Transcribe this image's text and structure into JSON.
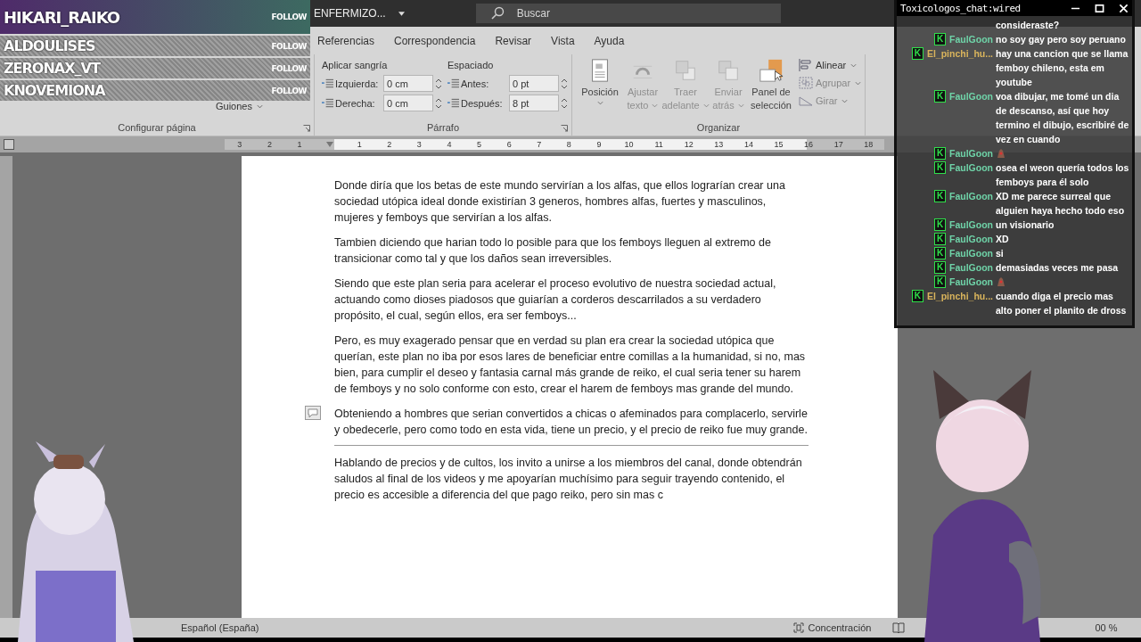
{
  "title_bar": {
    "document": "ENFERMIZO...",
    "search_placeholder": "Buscar"
  },
  "followers": [
    {
      "name": "HIKARI_RAIKO",
      "action": "FOLLOW"
    },
    {
      "name": "ALDOULISES",
      "action": "FOLLOW"
    },
    {
      "name": "ZERONAX_VT",
      "action": "FOLLOW"
    },
    {
      "name": "KNOVEMIONA",
      "action": "FOLLOW"
    }
  ],
  "ribbon_tabs": [
    "Referencias",
    "Correspondencia",
    "Revisar",
    "Vista",
    "Ayuda"
  ],
  "ribbon": {
    "page_setup": {
      "buttons": [
        "Guiones"
      ],
      "label": "Configurar página"
    },
    "paragraph": {
      "indent": {
        "title": "Aplicar sangría",
        "fields": [
          {
            "label": "Izquierda:",
            "value": "0 cm"
          },
          {
            "label": "Derecha:",
            "value": "0 cm"
          }
        ]
      },
      "spacing": {
        "title": "Espaciado",
        "fields": [
          {
            "label": "Antes:",
            "value": "0 pt"
          },
          {
            "label": "Después:",
            "value": "8 pt"
          }
        ]
      },
      "label": "Párrafo"
    },
    "arrange": {
      "large_buttons": [
        {
          "kind": "position",
          "lines": [
            "Posición"
          ],
          "dropdown": true,
          "disabled": false
        },
        {
          "kind": "wrap",
          "lines": [
            "Ajustar",
            "texto"
          ],
          "dropdown": true,
          "disabled": true
        },
        {
          "kind": "forward",
          "lines": [
            "Traer",
            "adelante"
          ],
          "dropdown": true,
          "disabled": true
        },
        {
          "kind": "backward",
          "lines": [
            "Enviar",
            "atrás"
          ],
          "dropdown": true,
          "disabled": true
        },
        {
          "kind": "selection",
          "lines": [
            "Panel de",
            "selección"
          ],
          "dropdown": false,
          "disabled": false
        }
      ],
      "small_buttons": [
        {
          "kind": "align",
          "label": "Alinear",
          "disabled": false
        },
        {
          "kind": "group",
          "label": "Agrupar",
          "disabled": true
        },
        {
          "kind": "rotate",
          "label": "Girar",
          "disabled": true
        }
      ],
      "label": "Organizar"
    }
  },
  "ruler": [
    "3",
    "2",
    "1",
    "1",
    "2",
    "3",
    "4",
    "5",
    "6",
    "7",
    "8",
    "9",
    "10",
    "11",
    "12",
    "13",
    "14",
    "15",
    "16",
    "17",
    "18"
  ],
  "paragraphs": [
    {
      "text": "Donde diría que los betas de este mundo servirían a los alfas, que ellos lograrían crear una sociedad utópica ideal donde existirían 3 generos, hombres alfas, fuertes y masculinos, mujeres y femboys que servirían a los alfas.",
      "comment": false,
      "border_below": false
    },
    {
      "text": "Tambien diciendo que harian todo lo posible para que los femboys lleguen al extremo de transicionar como tal y que los daños sean irreversibles.",
      "comment": false,
      "border_below": false
    },
    {
      "text": "Siendo que este plan seria para acelerar el proceso evolutivo de nuestra sociedad actual, actuando como dioses piadosos que guiarían a corderos descarrilados a su verdadero propósito, el cual, según ellos, era ser femboys...",
      "comment": false,
      "border_below": false
    },
    {
      "text": "Pero, es muy exagerado pensar que en verdad su plan era crear la sociedad utópica que querían, este plan no iba por esos lares de beneficiar entre comillas a la humanidad, si no, mas bien, para cumplir el deseo y fantasia carnal más grande de reiko, el cual seria tener su harem de femboys y no solo conforme con esto, crear el harem de femboys mas grande del mundo.",
      "comment": false,
      "border_below": false
    },
    {
      "text": "Obteniendo a hombres que serian convertidos a chicas o afeminados para complacerlo, servirle y obedecerle, pero como todo en esta vida, tiene un precio, y el precio de reiko fue muy grande.",
      "comment": true,
      "border_below": true
    },
    {
      "text": "Hablando de precios y de cultos, los invito a unirse a los miembros del canal, donde obtendrán saludos al final de los videos y me apoyarían muchísimo para seguir trayendo contenido, el precio es accesible a diferencia del que pago reiko, pero sin mas c",
      "comment": false,
      "border_below": false
    }
  ],
  "status_bar": {
    "language": "Español (España)",
    "focus": "Concentración",
    "zoom": "00 %"
  },
  "chat": {
    "title": "Toxicologos_chat:wired",
    "messages": [
      {
        "kind": "continued",
        "text": "consideraste?"
      },
      {
        "kind": "text",
        "badge": "K",
        "user": "FaulGoon",
        "color": "#6fd3a8",
        "text": "no soy gay pero soy peruano"
      },
      {
        "kind": "text",
        "badge": "K",
        "user": "El_pinchi_hu...",
        "color": "#d9b45c",
        "text": "hay una cancion que se llama femboy chileno, esta em youtube"
      },
      {
        "kind": "text",
        "badge": "K",
        "user": "FaulGoon",
        "color": "#6fd3a8",
        "text": "voa dibujar, me tomé un dia de descanso, así que hoy termino el dibujo, escribiré de vez en cuando"
      },
      {
        "kind": "emote",
        "badge": "K",
        "user": "FaulGoon",
        "color": "#6fd3a8"
      },
      {
        "kind": "text",
        "badge": "K",
        "user": "FaulGoon",
        "color": "#6fd3a8",
        "text": "osea el weon quería todos los femboys para él solo"
      },
      {
        "kind": "text",
        "badge": "K",
        "user": "FaulGoon",
        "color": "#6fd3a8",
        "text": "XD me parece surreal que alguien haya hecho todo eso"
      },
      {
        "kind": "text",
        "badge": "K",
        "user": "FaulGoon",
        "color": "#6fd3a8",
        "text": "un visionario"
      },
      {
        "kind": "text",
        "badge": "K",
        "user": "FaulGoon",
        "color": "#6fd3a8",
        "text": "XD"
      },
      {
        "kind": "text",
        "badge": "K",
        "user": "FaulGoon",
        "color": "#6fd3a8",
        "text": "si"
      },
      {
        "kind": "text",
        "badge": "K",
        "user": "FaulGoon",
        "color": "#6fd3a8",
        "text": "demasiadas veces me pasa"
      },
      {
        "kind": "emote",
        "badge": "K",
        "user": "FaulGoon",
        "color": "#6fd3a8"
      },
      {
        "kind": "text",
        "badge": "K",
        "user": "El_pinchi_hu...",
        "color": "#d9b45c",
        "text": "cuando diga el precio mas alto poner el planito de dross"
      }
    ]
  }
}
